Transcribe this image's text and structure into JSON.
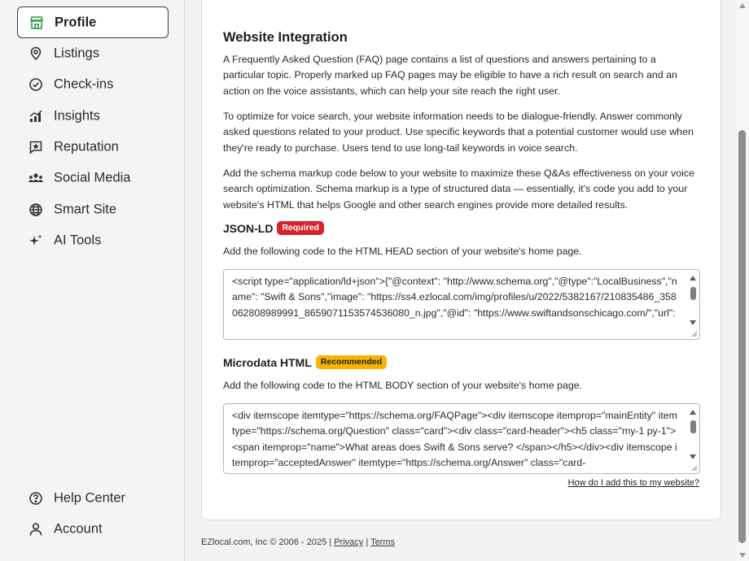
{
  "sidebar": {
    "items": [
      {
        "label": "Profile",
        "icon": "storefront-icon",
        "active": true
      },
      {
        "label": "Listings",
        "icon": "map-pin-icon"
      },
      {
        "label": "Check-ins",
        "icon": "check-circle-icon"
      },
      {
        "label": "Insights",
        "icon": "bar-chart-icon"
      },
      {
        "label": "Reputation",
        "icon": "star-message-icon"
      },
      {
        "label": "Social Media",
        "icon": "people-icon"
      },
      {
        "label": "Smart Site",
        "icon": "globe-icon"
      },
      {
        "label": "AI Tools",
        "icon": "sparkle-icon"
      }
    ],
    "bottom": [
      {
        "label": "Help Center",
        "icon": "help-circle-icon"
      },
      {
        "label": "Account",
        "icon": "user-icon"
      }
    ]
  },
  "main": {
    "title": "Website Integration",
    "paragraphs": [
      "A Frequently Asked Question (FAQ) page contains a list of questions and answers pertaining to a particular topic. Properly marked up FAQ pages may be eligible to have a rich result on search and an action on the voice assistants, which can help your site reach the right user.",
      "To optimize for voice search, your website information needs to be dialogue-friendly. Answer commonly asked questions related to your product. Use specific keywords that a potential customer would use when they're ready to purchase. Users tend to use long-tail keywords in voice search.",
      "Add the schema markup code below to your website to maximize these Q&As effectiveness on your voice search optimization. Schema markup is a type of structured data — essentially, it's code you add to your website's HTML that helps Google and other search engines provide more detailed results."
    ],
    "jsonld": {
      "heading": "JSON-LD",
      "badge": "Required",
      "instruction": "Add the following code to the HTML HEAD section of your website's home page.",
      "code": "<script type=\"application/ld+json\">{\"@context\": \"http://www.schema.org\",\"@type\":\"LocalBusiness\",\"name\": \"Swift & Sons\",\"image\": \"https://ss4.ezlocal.com/img/profiles/u/2022/5382167/210835486_358062808989991_8659071153574536080_n.jpg\",\"@id\": \"https://www.swiftandsonschicago.com/\",\"url\":"
    },
    "microdata": {
      "heading": "Microdata HTML",
      "badge": "Recommended",
      "instruction": "Add the following code to the HTML BODY section of your website's home page.",
      "code": "<div itemscope itemtype=\"https://schema.org/FAQPage\"><div itemscope itemprop=\"mainEntity\" itemtype=\"https://schema.org/Question\" class=\"card\"><div class=\"card-header\"><h5 class=\"my-1 py-1\"><span itemprop=\"name\">What areas does Swift & Sons serve? </span></h5></div><div itemscope itemprop=\"acceptedAnswer\" itemtype=\"https://schema.org/Answer\" class=\"card-"
    },
    "help_link": "How do I add this to my website?"
  },
  "footer": {
    "copyright": "EZlocal.com, Inc © 2006 - 2025 |",
    "privacy": "Privacy",
    "separator": "|",
    "terms": "Terms"
  },
  "colors": {
    "required_badge": "#d9232c",
    "recommended_badge": "#f6b400",
    "active_icon": "#2e9d4a"
  }
}
